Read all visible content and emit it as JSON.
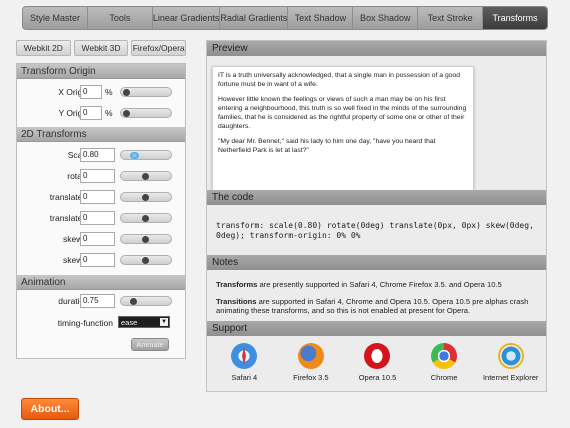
{
  "nav": {
    "tabs": [
      {
        "label": "Style Master"
      },
      {
        "label": "Tools"
      },
      {
        "label": "Linear Gradients"
      },
      {
        "label": "Radial Gradients"
      },
      {
        "label": "Text Shadow"
      },
      {
        "label": "Box Shadow"
      },
      {
        "label": "Text Stroke"
      },
      {
        "label": "Transforms"
      }
    ],
    "active": "Transforms"
  },
  "browser_tabs": [
    "Webkit 2D",
    "Webkit 3D",
    "Firefox/Opera"
  ],
  "transform_origin": {
    "title": "Transform Origin",
    "x_label": "X Origin",
    "x_value": "0",
    "y_label": "Y Origin",
    "y_value": "0",
    "unit": "%"
  },
  "transforms_2d": {
    "title": "2D Transforms",
    "scale_label": "Scale",
    "scale_value": "0.80",
    "rotate_label": "rotate",
    "rotate_value": "0",
    "translate_x_label": "translate x",
    "translate_x_value": "0",
    "translate_y_label": "translate y",
    "translate_y_value": "0",
    "skew_x_label": "skew x",
    "skew_x_value": "0",
    "skew_y_label": "skew y",
    "skew_y_value": "0"
  },
  "animation": {
    "title": "Animation",
    "duration_label": "duration",
    "duration_value": "0.75",
    "timing_label": "timing-function",
    "timing_value": "ease",
    "animate_label": "Animate"
  },
  "preview": {
    "title": "Preview",
    "p1": "IT is a truth universally acknowledged, that a single man in possession of a good fortune must be in want of a wife.",
    "p2": "However little known the feelings or views of such a man may be on his first entering a neighbourhood, this truth is so well fixed in the minds of the surrounding families, that he is considered as the rightful property of some one or other of their daughters.",
    "p3": "\"My dear Mr. Bennet,\" said his lady to him one day, \"have you heard that Netherfield Park is let at last?\""
  },
  "code": {
    "title": "The code",
    "text": "transform: scale(0.80) rotate(0deg) translate(0px, 0px) skew(0deg, 0deg); transform-origin: 0% 0%"
  },
  "notes": {
    "title": "Notes",
    "n1_bold": "Transforms",
    "n1_rest": " are presently supported in Safari 4, Chrome Firefox 3.5. and Opera 10.5",
    "n2_bold": "Transitions",
    "n2_rest": " are supported in Safari 4, Chrome and Opera 10.5. Opera 10.5 pre alphas crash animating these transforms, and so this is not enabled at present for Opera."
  },
  "support": {
    "title": "Support",
    "browsers": [
      {
        "name": "Safari 4",
        "icon": "safari-icon"
      },
      {
        "name": "Firefox 3.5",
        "icon": "firefox-icon"
      },
      {
        "name": "Opera 10.5",
        "icon": "opera-icon"
      },
      {
        "name": "Chrome",
        "icon": "chrome-icon"
      },
      {
        "name": "Internet Explorer",
        "icon": "ie-icon"
      }
    ]
  },
  "about_label": "About...",
  "colors": {
    "about": "#f26a1b",
    "active_tab": "#4a4a4a",
    "slider_knob_active": "#2a8ed0"
  }
}
